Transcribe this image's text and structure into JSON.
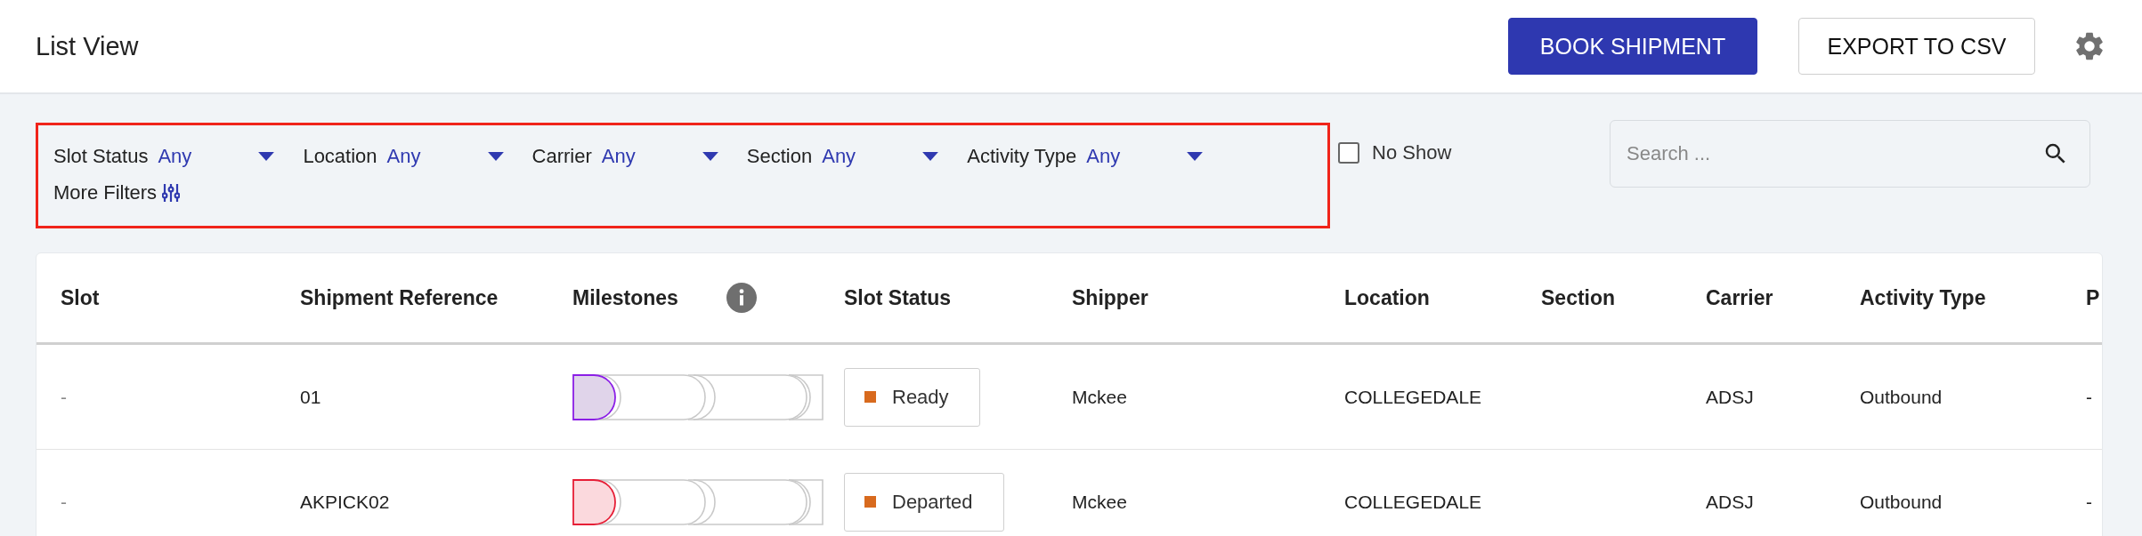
{
  "header": {
    "title": "List View",
    "buttons": [
      {
        "label": "BOOK SHIPMENT",
        "kind": "primary"
      },
      {
        "label": "EXPORT TO CSV",
        "kind": "secondary"
      }
    ]
  },
  "filters": [
    {
      "label": "Slot Status",
      "value": "Any"
    },
    {
      "label": "Location",
      "value": "Any"
    },
    {
      "label": "Carrier",
      "value": "Any"
    },
    {
      "label": "Section",
      "value": "Any"
    },
    {
      "label": "Activity Type",
      "value": "Any"
    }
  ],
  "more_filters": "More Filters",
  "no_show": {
    "label": "No Show",
    "checked": false
  },
  "search": {
    "placeholder": "Search ..."
  },
  "table": {
    "columns": [
      "Slot",
      "Shipment Reference",
      "Milestones",
      "Slot Status",
      "Shipper",
      "Location",
      "Section",
      "Carrier",
      "Activity Type",
      "P"
    ],
    "rows": [
      {
        "slot": "-",
        "reference": "01",
        "milestone": {
          "color": "#e0d4ea"
        },
        "status": {
          "label": "Ready",
          "color": "#d86a1e"
        },
        "shipper": "Mckee",
        "location": "COLLEGEDALE",
        "carrier": "ADSJ",
        "activity": "Outbound",
        "column_10": "-"
      },
      {
        "slot": "-",
        "reference": "AKPICK02",
        "milestone": {
          "color": "#fbd9dd"
        },
        "status": {
          "label": "Departed",
          "color": "#d86a1e"
        },
        "shipper": "Mckee",
        "location": "COLLEGEDALE",
        "carrier": "ADSJ",
        "activity": "Outbound",
        "column_10": "-"
      }
    ]
  }
}
